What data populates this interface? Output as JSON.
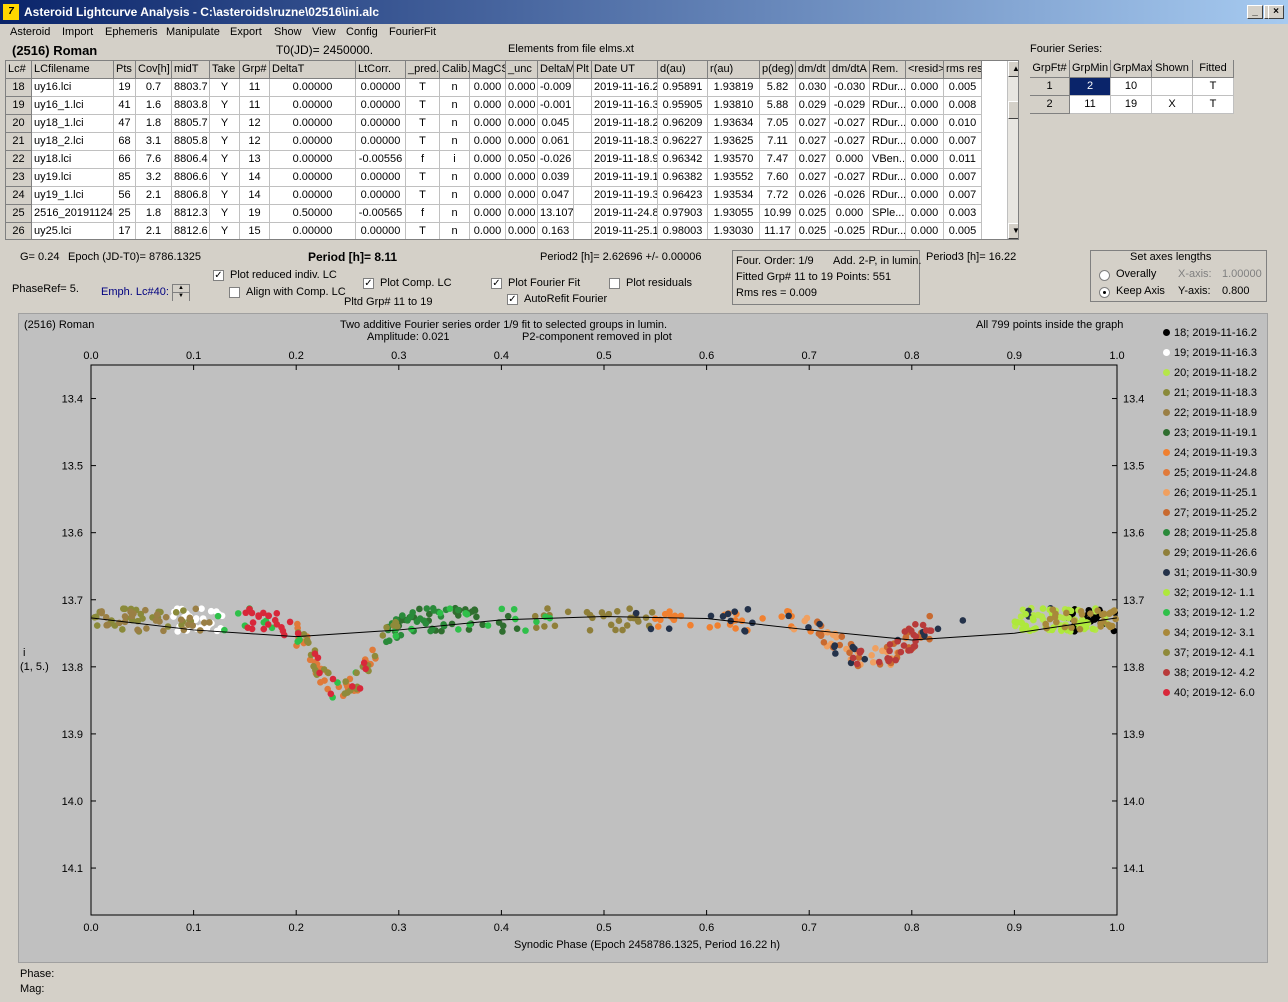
{
  "window": {
    "title": "Asteroid Lightcurve Analysis - C:\\asteroids\\ruzne\\02516\\ini.alc",
    "controls": [
      "_",
      "□",
      "×"
    ]
  },
  "menu": [
    "Asteroid",
    "Import",
    "Ephemeris",
    "Manipulate",
    "Export",
    "Show",
    "View",
    "Config",
    "FourierFit"
  ],
  "header": {
    "asteroid": "(2516) Roman",
    "t0": "T0(JD)= 2450000.",
    "elements": "Elements from file elms.xt"
  },
  "table": {
    "columns": [
      "Lc#",
      "LCfilename",
      "Pts",
      "Cov[h]",
      "midT",
      "Take",
      "Grp#",
      "DeltaT",
      "LtCorr.",
      "_pred.",
      "Calib.",
      "MagCS",
      "_unc",
      "DeltaM",
      "Plt",
      "Date UT",
      "d(au)",
      "r(au)",
      "p(deg)",
      "dm/dt",
      "dm/dtA",
      "Rem.",
      "<resid>",
      "rms res"
    ],
    "rows": [
      [
        "18",
        "uy16.lci",
        "19",
        "0.7",
        "8803.7",
        "Y",
        "11",
        "0.00000",
        "0.00000",
        "T",
        "n",
        "0.000",
        "0.000",
        "-0.009",
        "",
        "2019-11-16.2",
        "0.95891",
        "1.93819",
        "5.82",
        "0.030",
        "-0.030",
        "RDur...",
        "0.000",
        "0.005"
      ],
      [
        "19",
        "uy16_1.lci",
        "41",
        "1.6",
        "8803.8",
        "Y",
        "11",
        "0.00000",
        "0.00000",
        "T",
        "n",
        "0.000",
        "0.000",
        "-0.001",
        "",
        "2019-11-16.3",
        "0.95905",
        "1.93810",
        "5.88",
        "0.029",
        "-0.029",
        "RDur...",
        "0.000",
        "0.008"
      ],
      [
        "20",
        "uy18_1.lci",
        "47",
        "1.8",
        "8805.7",
        "Y",
        "12",
        "0.00000",
        "0.00000",
        "T",
        "n",
        "0.000",
        "0.000",
        "0.045",
        "",
        "2019-11-18.2",
        "0.96209",
        "1.93634",
        "7.05",
        "0.027",
        "-0.027",
        "RDur...",
        "0.000",
        "0.010"
      ],
      [
        "21",
        "uy18_2.lci",
        "68",
        "3.1",
        "8805.8",
        "Y",
        "12",
        "0.00000",
        "0.00000",
        "T",
        "n",
        "0.000",
        "0.000",
        "0.061",
        "",
        "2019-11-18.3",
        "0.96227",
        "1.93625",
        "7.11",
        "0.027",
        "-0.027",
        "RDur...",
        "0.000",
        "0.007"
      ],
      [
        "22",
        "uy18.lci",
        "66",
        "7.6",
        "8806.4",
        "Y",
        "13",
        "0.00000",
        "-0.00556",
        "f",
        "i",
        "0.000",
        "0.050",
        "-0.026",
        "",
        "2019-11-18.9",
        "0.96342",
        "1.93570",
        "7.47",
        "0.027",
        "0.000",
        "VBen...",
        "0.000",
        "0.011"
      ],
      [
        "23",
        "uy19.lci",
        "85",
        "3.2",
        "8806.6",
        "Y",
        "14",
        "0.00000",
        "0.00000",
        "T",
        "n",
        "0.000",
        "0.000",
        "0.039",
        "",
        "2019-11-19.1",
        "0.96382",
        "1.93552",
        "7.60",
        "0.027",
        "-0.027",
        "RDur...",
        "0.000",
        "0.007"
      ],
      [
        "24",
        "uy19_1.lci",
        "56",
        "2.1",
        "8806.8",
        "Y",
        "14",
        "0.00000",
        "0.00000",
        "T",
        "n",
        "0.000",
        "0.000",
        "0.047",
        "",
        "2019-11-19.3",
        "0.96423",
        "1.93534",
        "7.72",
        "0.026",
        "-0.026",
        "RDur...",
        "0.000",
        "0.007"
      ],
      [
        "25",
        "2516_20191124",
        "25",
        "1.8",
        "8812.3",
        "Y",
        "19",
        "0.50000",
        "-0.00565",
        "f",
        "n",
        "0.000",
        "0.000",
        "13.107",
        "",
        "2019-11-24.8",
        "0.97903",
        "1.93055",
        "10.99",
        "0.025",
        "0.000",
        "SPle...",
        "0.000",
        "0.003"
      ],
      [
        "26",
        "uy25.lci",
        "17",
        "2.1",
        "8812.6",
        "Y",
        "15",
        "0.00000",
        "0.00000",
        "T",
        "n",
        "0.000",
        "0.000",
        "0.163",
        "",
        "2019-11-25.1",
        "0.98003",
        "1.93030",
        "11.17",
        "0.025",
        "-0.025",
        "RDur...",
        "0.000",
        "0.005"
      ]
    ]
  },
  "fourier_table": {
    "title": "Fourier Series:",
    "columns": [
      "GrpFt#",
      "GrpMin",
      "GrpMax",
      "Shown",
      "Fitted"
    ],
    "rows": [
      [
        "1",
        "2",
        "10",
        "",
        "T"
      ],
      [
        "2",
        "11",
        "19",
        "X",
        "T"
      ]
    ]
  },
  "info": {
    "g": "G= 0.24",
    "epoch": "Epoch (JD-T0)= 8786.1325",
    "period": "Period [h]= 8.11",
    "period2": "Period2 [h]= 2.62696 +/- 0.00006",
    "period3": "Period3 [h]= 16.22",
    "phaseref": "PhaseRef= 5.",
    "emph": "Emph. Lc#40:",
    "four_order": "Four. Order:  1/9",
    "add2p": "Add. 2-P, in lumin.",
    "fitted": "Fitted Grp# 11 to 19 Points: 551",
    "rms": "Rms res     = 0.009",
    "pltd": "Pltd Grp#  11 to   19"
  },
  "checks": {
    "plot_reduced": {
      "label": "Plot reduced indiv. LC",
      "checked": true
    },
    "align": {
      "label": "Align with Comp. LC",
      "checked": false
    },
    "plot_comp": {
      "label": "Plot Comp. LC",
      "checked": true
    },
    "plot_fourier": {
      "label": "Plot Fourier Fit",
      "checked": true
    },
    "autorefit": {
      "label": "AutoRefit Fourier",
      "checked": true
    },
    "plot_residuals": {
      "label": "Plot residuals",
      "checked": false
    }
  },
  "axes_box": {
    "title": "Set axes lengths",
    "overally": "Overally",
    "keep": "Keep Axis",
    "xaxis_label": "X-axis:",
    "xaxis_val": "1.00000",
    "yaxis_label": "Y-axis:",
    "yaxis_val": "0.800"
  },
  "plot": {
    "name": "(2516) Roman",
    "desc1": "Two additive Fourier series order 1/9 fit to selected groups in lumin.",
    "desc2": "Amplitude: 0.021",
    "desc3": "P2-component removed in plot",
    "points_note": "All 799 points inside the graph",
    "xlabel": "Synodic Phase (Epoch 2458786.1325, Period 16.22 h)",
    "ylabel1": "i",
    "ylabel2": "(1, 5.)"
  },
  "chart_data": {
    "type": "scatter",
    "xlim": [
      0,
      1
    ],
    "ylim": [
      13.35,
      14.17
    ],
    "y_inverted": true,
    "x_ticks": [
      "0.0",
      "0.1",
      "0.2",
      "0.3",
      "0.4",
      "0.5",
      "0.6",
      "0.7",
      "0.8",
      "0.9",
      "1.0"
    ],
    "y_ticks": [
      "13.4",
      "13.5",
      "13.6",
      "13.7",
      "13.8",
      "13.9",
      "14.0",
      "14.1"
    ],
    "fit_line": [
      [
        0,
        13.727
      ],
      [
        0.1,
        13.745
      ],
      [
        0.2,
        13.755
      ],
      [
        0.3,
        13.745
      ],
      [
        0.4,
        13.73
      ],
      [
        0.5,
        13.725
      ],
      [
        0.6,
        13.728
      ],
      [
        0.7,
        13.745
      ],
      [
        0.8,
        13.76
      ],
      [
        0.9,
        13.75
      ],
      [
        1.0,
        13.727
      ]
    ],
    "series": [
      {
        "name": "18; 2019-11-16.2",
        "color": "#000000",
        "x_range": [
          0.95,
          1.0
        ],
        "center": 13.73,
        "dip": 0
      },
      {
        "name": "19; 2019-11-16.3",
        "color": "#ffffff",
        "x_range": [
          0.08,
          0.13
        ],
        "center": 13.74,
        "dip": 0
      },
      {
        "name": "20; 2019-11-18.2",
        "color": "#b5e64a",
        "x_range": [
          0.9,
          1.0
        ],
        "center": 13.735,
        "dip": 0
      },
      {
        "name": "21; 2019-11-18.3",
        "color": "#8a8a3a",
        "x_range": [
          0.0,
          0.1
        ],
        "center": 13.73,
        "dip": 0
      },
      {
        "name": "22; 2019-11-18.9",
        "color": "#9a7f45",
        "x_range": [
          0.0,
          0.12
        ],
        "center": 13.73,
        "dip": 0
      },
      {
        "name": "23; 2019-11-19.1",
        "color": "#2f6e2f",
        "x_range": [
          0.3,
          0.42
        ],
        "center": 13.74,
        "dip": 0.05
      },
      {
        "name": "24; 2019-11-19.3",
        "color": "#f08030",
        "x_range": [
          0.55,
          0.72
        ],
        "center": 13.74,
        "dip": 0
      },
      {
        "name": "25; 2019-11-24.8",
        "color": "#e07a3a",
        "x_range": [
          0.2,
          0.28
        ],
        "center": 13.83,
        "dip": 0
      },
      {
        "name": "26; 2019-11-25.1",
        "color": "#f0a060",
        "x_range": [
          0.68,
          0.8
        ],
        "center": 13.78,
        "dip": 0
      },
      {
        "name": "27; 2019-11-25.2",
        "color": "#c86a30",
        "x_range": [
          0.7,
          0.82
        ],
        "center": 13.79,
        "dip": 0
      },
      {
        "name": "28; 2019-11-25.8",
        "color": "#2a8a3a",
        "x_range": [
          0.28,
          0.36
        ],
        "center": 13.76,
        "dip": 0
      },
      {
        "name": "29; 2019-11-26.6",
        "color": "#8f7f3a",
        "x_range": [
          0.43,
          0.55
        ],
        "center": 13.73,
        "dip": 0
      },
      {
        "name": "31; 2019-11-30.9",
        "color": "#24324a",
        "x_range": [
          0.52,
          0.95
        ],
        "center": 13.74,
        "dip": 0
      },
      {
        "name": "32; 2019-12- 1.1",
        "color": "#aee83c",
        "x_range": [
          0.9,
          0.98
        ],
        "center": 13.74,
        "dip": 0
      },
      {
        "name": "33; 2019-12- 1.2",
        "color": "#2fc04a",
        "x_range": [
          0.12,
          0.45
        ],
        "center": 13.745,
        "dip": 0
      },
      {
        "name": "34; 2019-12- 3.1",
        "color": "#a8883a",
        "x_range": [
          0.93,
          1.0
        ],
        "center": 13.72,
        "dip": 0
      },
      {
        "name": "37; 2019-12- 4.1",
        "color": "#8f8a3a",
        "x_range": [
          0.2,
          0.3
        ],
        "center": 13.84,
        "dip": 0
      },
      {
        "name": "38; 2019-12- 4.2",
        "color": "#b83a3a",
        "x_range": [
          0.74,
          0.82
        ],
        "center": 13.8,
        "dip": 0
      },
      {
        "name": "40; 2019-12- 6.0",
        "color": "#d8283a",
        "x_range": [
          0.15,
          0.27
        ],
        "center": 13.83,
        "dip": 0
      }
    ]
  },
  "status": {
    "phase": "Phase:",
    "mag": "Mag:"
  }
}
